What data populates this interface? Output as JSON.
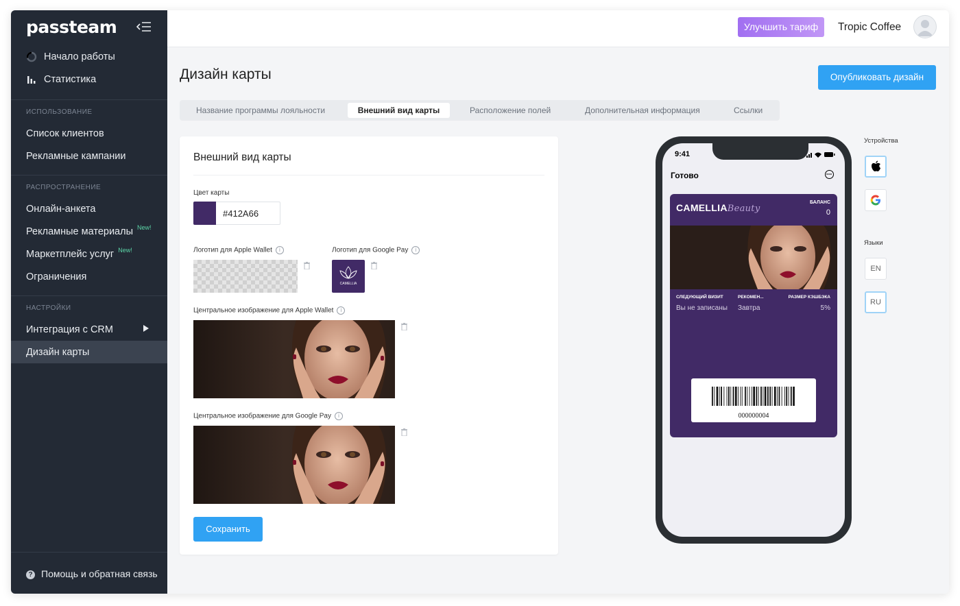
{
  "brand": {
    "logo": "passteam"
  },
  "sidebar": {
    "top_items": [
      {
        "label": "Начало работы",
        "icon": "spinner-icon"
      },
      {
        "label": "Статистика",
        "icon": "bar-chart-icon"
      }
    ],
    "sections": [
      {
        "title": "ИСПОЛЬЗОВАНИЕ",
        "items": [
          {
            "label": "Список клиентов"
          },
          {
            "label": "Рекламные кампании"
          }
        ]
      },
      {
        "title": "РАСПРОСТРАНЕНИЕ",
        "items": [
          {
            "label": "Онлайн-анкета"
          },
          {
            "label": "Рекламные материалы",
            "badge": "New!"
          },
          {
            "label": "Маркетплейс услуг",
            "badge": "New!"
          },
          {
            "label": "Ограничения"
          }
        ]
      },
      {
        "title": "НАСТРОЙКИ",
        "items": [
          {
            "label": "Интеграция с CRM"
          },
          {
            "label": "Дизайн карты"
          }
        ]
      }
    ],
    "help": "Помощь и обратная связь"
  },
  "topbar": {
    "upgrade_label": "Улучшить тариф",
    "account_name": "Tropic Coffee"
  },
  "page": {
    "title": "Дизайн карты",
    "publish_label": "Опубликовать дизайн",
    "tabs": [
      "Название программы лояльности",
      "Внешний вид карты",
      "Расположение полей",
      "Дополнительная информация",
      "Ссылки"
    ],
    "active_tab": 1
  },
  "form": {
    "title": "Внешний вид карты",
    "color_label": "Цвет карты",
    "color_value": "#412A66",
    "apple_logo_label": "Логотип для Apple Wallet",
    "google_logo_label": "Логотип для Google Pay",
    "apple_image_label": "Центральное изображение для Apple Wallet",
    "google_image_label": "Центральное изображение для Google Pay",
    "google_logo_text": "CAMELLIA",
    "save_label": "Сохранить"
  },
  "preview": {
    "time": "9:41",
    "done": "Готово",
    "brand": "CAMELLIA",
    "brand_script": "Beauty",
    "balance_label": "БАЛАНС",
    "balance_value": "0",
    "fields": [
      {
        "label": "СЛЕДУЮЩИЙ ВИЗИТ",
        "value": "Вы не записаны"
      },
      {
        "label": "РЕКОМЕН...",
        "value": "Завтра"
      },
      {
        "label": "РАЗМЕР КЭШБЭКА",
        "value": "5%"
      }
    ],
    "barcode_number": "000000004"
  },
  "right_panel": {
    "devices_label": "Устройства",
    "languages_label": "Языки",
    "languages": [
      "EN",
      "RU"
    ],
    "selected_language": "RU"
  },
  "colors": {
    "card": "#412a66",
    "accent": "#30a2f3",
    "sidebar": "#232a35",
    "upgrade": "#a16ff1"
  }
}
